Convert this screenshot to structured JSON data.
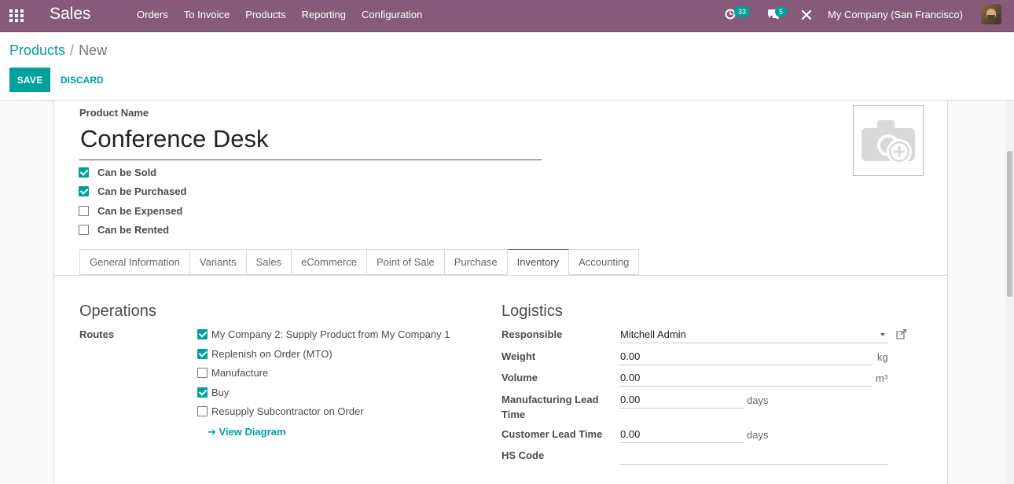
{
  "navbar": {
    "app_name": "Sales",
    "menu": [
      "Orders",
      "To Invoice",
      "Products",
      "Reporting",
      "Configuration"
    ],
    "activity_count": "33",
    "messages_count": "5",
    "company": "My Company (San Francisco)"
  },
  "breadcrumb": {
    "parent": "Products",
    "separator": "/",
    "current": "New"
  },
  "actions": {
    "save": "SAVE",
    "discard": "DISCARD"
  },
  "form": {
    "product_name_label": "Product Name",
    "product_name": "Conference Desk",
    "options": [
      {
        "label": "Can be Sold",
        "checked": true
      },
      {
        "label": "Can be Purchased",
        "checked": true
      },
      {
        "label": "Can be Expensed",
        "checked": false
      },
      {
        "label": "Can be Rented",
        "checked": false
      }
    ],
    "tabs": [
      "General Information",
      "Variants",
      "Sales",
      "eCommerce",
      "Point of Sale",
      "Purchase",
      "Inventory",
      "Accounting"
    ],
    "active_tab": "Inventory"
  },
  "operations": {
    "title": "Operations",
    "routes_label": "Routes",
    "routes": [
      {
        "label": "My Company 2: Supply Product from My Company 1",
        "checked": true
      },
      {
        "label": "Replenish on Order (MTO)",
        "checked": true
      },
      {
        "label": "Manufacture",
        "checked": false
      },
      {
        "label": "Buy",
        "checked": true
      },
      {
        "label": "Resupply Subcontractor on Order",
        "checked": false
      }
    ],
    "view_diagram": "View Diagram"
  },
  "logistics": {
    "title": "Logistics",
    "responsible_label": "Responsible",
    "responsible": "Mitchell Admin",
    "weight_label": "Weight",
    "weight": "0.00",
    "weight_unit": "kg",
    "volume_label": "Volume",
    "volume": "0.00",
    "volume_unit": "m³",
    "mfg_lead_label_1": "Manufacturing Lead",
    "mfg_lead_label_2": "Time",
    "mfg_lead": "0.00",
    "mfg_lead_unit": "days",
    "customer_lead_label": "Customer Lead Time",
    "customer_lead": "0.00",
    "customer_lead_unit": "days",
    "hs_code_label": "HS Code",
    "hs_code": ""
  },
  "colors": {
    "navbar": "#875a7b",
    "accent": "#00a09d"
  }
}
